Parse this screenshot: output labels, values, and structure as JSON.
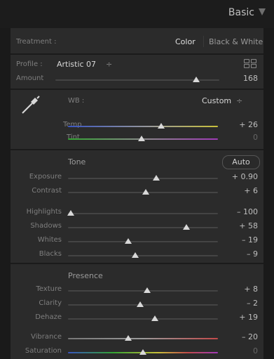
{
  "panel": {
    "title": "Basic"
  },
  "treatment": {
    "label": "Treatment :",
    "color": "Color",
    "bw": "Black & White"
  },
  "profile": {
    "label": "Profile :",
    "name": "Artistic 07",
    "caret": "÷",
    "amount_label": "Amount",
    "amount_value": "168",
    "amount_level": 0.86
  },
  "wb": {
    "label": "WB :",
    "value": "Custom",
    "caret": "÷",
    "temp": {
      "label": "Temp",
      "value": "+ 26",
      "level": 0.62
    },
    "tint": {
      "label": "Tint",
      "value": "0",
      "level": 0.49
    }
  },
  "tone": {
    "title": "Tone",
    "auto": "Auto",
    "exposure": {
      "label": "Exposure",
      "value": "+ 0.90",
      "level": 0.59
    },
    "contrast": {
      "label": "Contrast",
      "value": "+ 6",
      "level": 0.52
    },
    "highlights": {
      "label": "Highlights",
      "value": "– 100",
      "level": 0.02
    },
    "shadows": {
      "label": "Shadows",
      "value": "+ 58",
      "level": 0.79
    },
    "whites": {
      "label": "Whites",
      "value": "– 19",
      "level": 0.4
    },
    "blacks": {
      "label": "Blacks",
      "value": "– 9",
      "level": 0.45
    }
  },
  "presence": {
    "title": "Presence",
    "texture": {
      "label": "Texture",
      "value": "+ 8",
      "level": 0.53
    },
    "clarity": {
      "label": "Clarity",
      "value": "– 2",
      "level": 0.48
    },
    "dehaze": {
      "label": "Dehaze",
      "value": "+ 19",
      "level": 0.58
    },
    "vibrance": {
      "label": "Vibrance",
      "value": "– 20",
      "level": 0.4
    },
    "saturation": {
      "label": "Saturation",
      "value": "0",
      "level": 0.5
    }
  },
  "colors": {
    "panel_bg": "#2b2b2b",
    "header_bg": "#1c1c1c",
    "knob": "#d8d8d8",
    "temp_left": "#3a55c0",
    "temp_right": "#c8c03a",
    "tint_left": "#33a433",
    "tint_right": "#a03ab8"
  },
  "icons": {
    "panel_collapse": "triangle-down-icon",
    "eyedropper": "eyedropper-icon",
    "profile_browser": "grid-icon"
  }
}
